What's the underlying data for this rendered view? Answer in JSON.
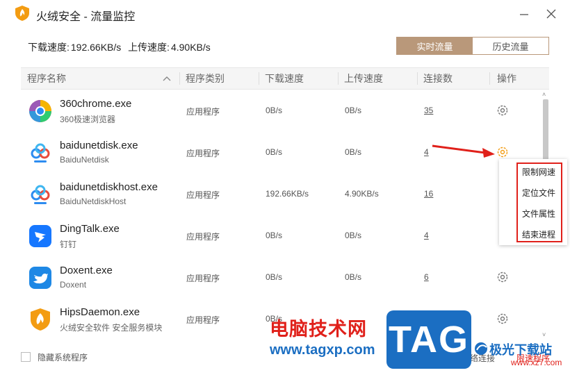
{
  "window": {
    "title": "火绒安全 - 流量监控",
    "brand_color": "#f39c12"
  },
  "speed": {
    "download_label": "下载速度:",
    "download_value": "192.66KB/s",
    "upload_label": "上传速度:",
    "upload_value": "4.90KB/s"
  },
  "tabs": [
    {
      "label": "实时流量",
      "active": true
    },
    {
      "label": "历史流量",
      "active": false
    }
  ],
  "columns": [
    "程序名称",
    "程序类别",
    "下载速度",
    "上传速度",
    "连接数",
    "操作"
  ],
  "rows": [
    {
      "name": "360chrome.exe",
      "desc": "360极速浏览器",
      "type": "应用程序",
      "download": "0B/s",
      "upload": "0B/s",
      "connections": "35",
      "icon": "360chrome-icon"
    },
    {
      "name": "baidunetdisk.exe",
      "desc": "BaiduNetdisk",
      "type": "应用程序",
      "download": "0B/s",
      "upload": "0B/s",
      "connections": "4",
      "icon": "baidunetdisk-icon"
    },
    {
      "name": "baidunetdiskhost.exe",
      "desc": "BaiduNetdiskHost",
      "type": "应用程序",
      "download": "192.66KB/s",
      "upload": "4.90KB/s",
      "connections": "16",
      "icon": "baidunetdisk-icon"
    },
    {
      "name": "DingTalk.exe",
      "desc": "钉钉",
      "type": "应用程序",
      "download": "0B/s",
      "upload": "0B/s",
      "connections": "4",
      "icon": "dingtalk-icon"
    },
    {
      "name": "Doxent.exe",
      "desc": "Doxent",
      "type": "应用程序",
      "download": "0B/s",
      "upload": "0B/s",
      "connections": "6",
      "icon": "doxent-icon"
    },
    {
      "name": "HipsDaemon.exe",
      "desc": "火绒安全软件 安全服务模块",
      "type": "应用程序",
      "download": "0B/s",
      "upload": "",
      "connections": "",
      "icon": "huorong-icon"
    }
  ],
  "context_menu": [
    "限制网速",
    "定位文件",
    "文件属性",
    "结束进程"
  ],
  "footer": {
    "hide_system_label": "隐藏系统程序",
    "link1": "查看网络连接",
    "link2": "限速程序"
  },
  "watermark": {
    "cn": "电脑技术网",
    "url": "www.tagxp.com",
    "tag": "TAG",
    "site": "极光下载站",
    "site_url": "www.xz7.com"
  }
}
